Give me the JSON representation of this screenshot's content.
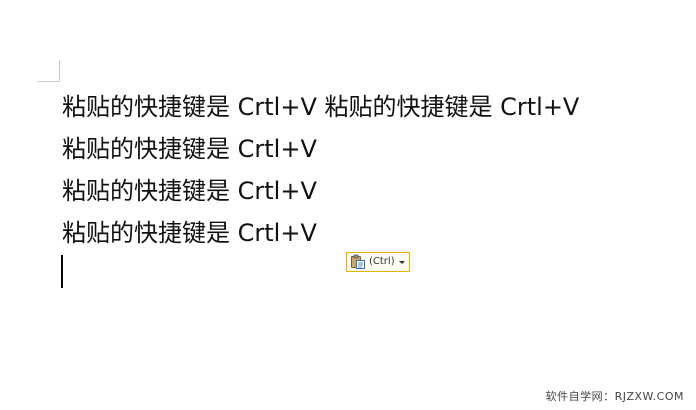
{
  "document": {
    "lines": [
      "粘贴的快捷键是 Crtl+V 粘贴的快捷键是 Crtl+V",
      "粘贴的快捷键是 Crtl+V",
      "粘贴的快捷键是 Crtl+V",
      "粘贴的快捷键是 Crtl+V"
    ]
  },
  "paste_options": {
    "label": "(Ctrl)",
    "icon": "clipboard-icon",
    "border_color": "#e6b400"
  },
  "watermark": {
    "text": "软件自学网：RJZXW.COM"
  }
}
